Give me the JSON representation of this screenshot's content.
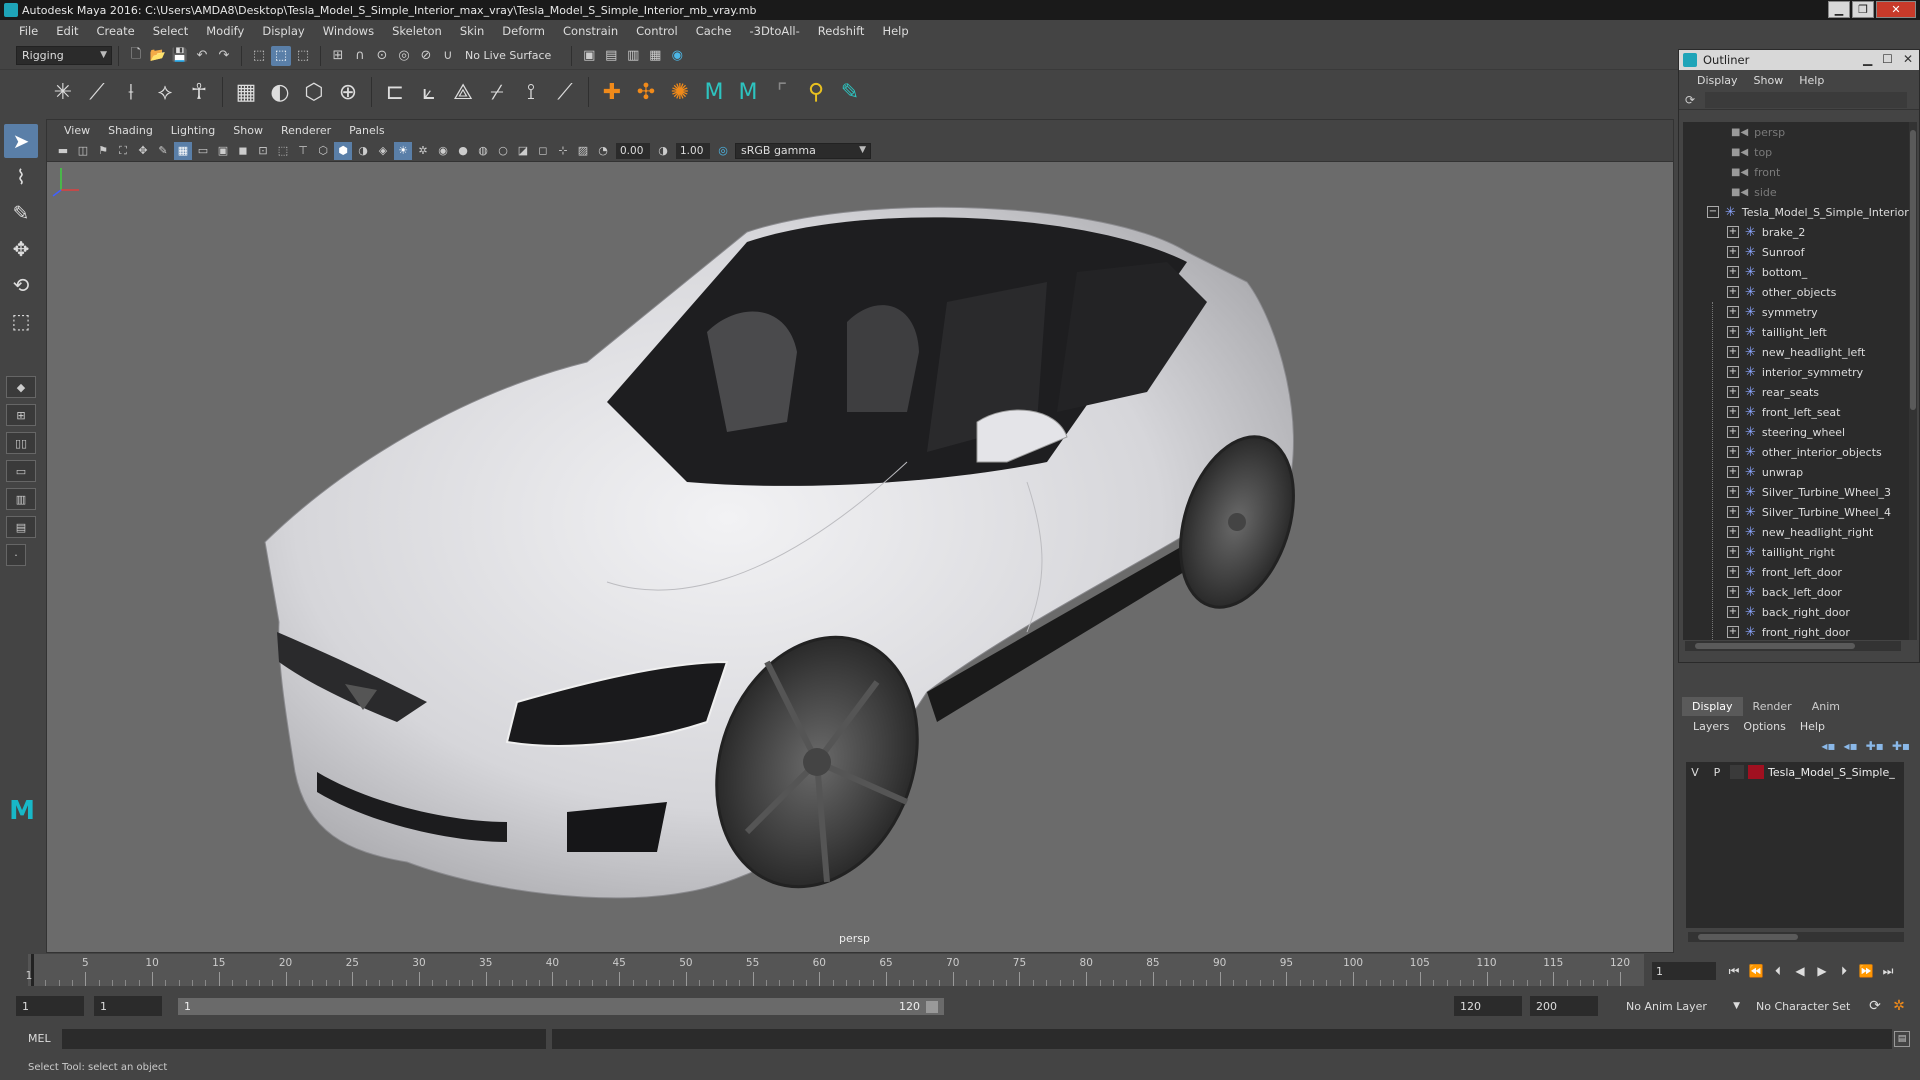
{
  "window": {
    "title": "Autodesk Maya 2016: C:\\Users\\AMDA8\\Desktop\\Tesla_Model_S_Simple_Interior_max_vray\\Tesla_Model_S_Simple_Interior_mb_vray.mb",
    "minimize": "▁",
    "restore": "❐",
    "close": "✕"
  },
  "menubar": [
    "File",
    "Edit",
    "Create",
    "Select",
    "Modify",
    "Display",
    "Windows",
    "Skeleton",
    "Skin",
    "Deform",
    "Constrain",
    "Control",
    "Cache",
    "-3DtoAll-",
    "Redshift",
    "Help"
  ],
  "statusline": {
    "menuset": "Rigging",
    "live_surface": "No Live Surface"
  },
  "viewport": {
    "panel_menu": [
      "View",
      "Shading",
      "Lighting",
      "Show",
      "Renderer",
      "Panels"
    ],
    "exposure": "0.00",
    "gamma": "1.00",
    "color_space": "sRGB gamma",
    "camera_label": "persp"
  },
  "outliner": {
    "title": "Outliner",
    "menu": [
      "Display",
      "Show",
      "Help"
    ],
    "cameras": [
      "persp",
      "top",
      "front",
      "side"
    ],
    "root": "Tesla_Model_S_Simple_Interior",
    "children": [
      "brake_2",
      "Sunroof",
      "bottom_",
      "other_objects",
      "symmetry",
      "taillight_left",
      "new_headlight_left",
      "interior_symmetry",
      "rear_seats",
      "front_left_seat",
      "steering_wheel",
      "other_interior_objects",
      "unwrap",
      "Silver_Turbine_Wheel_3",
      "Silver_Turbine_Wheel_4",
      "new_headlight_right",
      "taillight_right",
      "front_left_door",
      "back_left_door",
      "back_right_door",
      "front_right_door"
    ]
  },
  "layer_editor": {
    "tabs": [
      "Display",
      "Render",
      "Anim"
    ],
    "menu": [
      "Layers",
      "Options",
      "Help"
    ],
    "layer": {
      "v": "V",
      "p": "P",
      "name": "Tesla_Model_S_Simple_",
      "color": "#a01020"
    }
  },
  "timeslider": {
    "ticks": [
      "5",
      "10",
      "15",
      "20",
      "25",
      "30",
      "35",
      "40",
      "45",
      "50",
      "55",
      "60",
      "65",
      "70",
      "75",
      "80",
      "85",
      "90",
      "95",
      "100",
      "105",
      "110",
      "115",
      "120"
    ],
    "start_label": "1",
    "range_min": 1,
    "range_max": 120,
    "current_frame": 1,
    "current_frame_field": "1"
  },
  "rangebar": {
    "start_field": "1",
    "anim_start_field": "1",
    "range_start": "1",
    "range_end": "120",
    "end_field": "120",
    "anim_end_field": "200",
    "anim_layer": "No Anim Layer",
    "character_set": "No Character Set"
  },
  "cmdline": {
    "label": "MEL"
  },
  "helpline": {
    "text": "Select Tool: select an object"
  },
  "colors": {
    "accent": "#5a7fa8",
    "maya_teal": "#1ea4b8",
    "viewport_bg": "#6b6b6b"
  }
}
